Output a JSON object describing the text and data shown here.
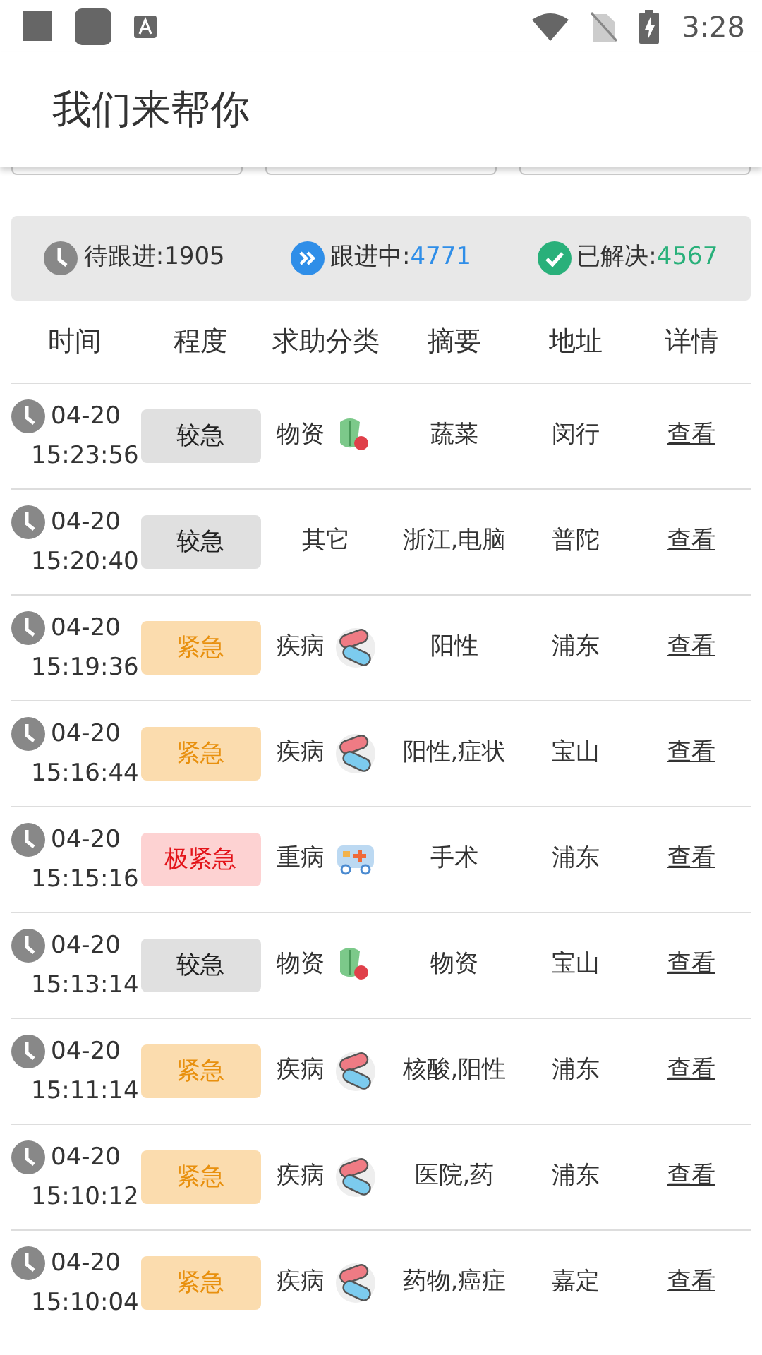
{
  "status_bar": {
    "time": "3:28"
  },
  "app_bar": {
    "title": "我们来帮你"
  },
  "summary": [
    {
      "kind": "pending",
      "label": "待跟进:",
      "count": "1905"
    },
    {
      "kind": "following",
      "label": "跟进中:",
      "count": "4771"
    },
    {
      "kind": "resolved",
      "label": "已解决:",
      "count": "4567"
    }
  ],
  "table": {
    "columns": [
      "时间",
      "程度",
      "求助分类",
      "摘要",
      "地址",
      "详情"
    ],
    "rows": [
      {
        "date": "04-20",
        "time": "15:23:56",
        "urgency": {
          "text": "较急",
          "kind": "moderate"
        },
        "category": {
          "text": "物资",
          "kind": "vegetables"
        },
        "summary": "蔬菜",
        "address": "闵行",
        "detail": "查看"
      },
      {
        "date": "04-20",
        "time": "15:20:40",
        "urgency": {
          "text": "较急",
          "kind": "moderate"
        },
        "category": {
          "text": "其它",
          "kind": "plain"
        },
        "summary": "浙江,电脑",
        "address": "普陀",
        "detail": "查看"
      },
      {
        "date": "04-20",
        "time": "15:19:36",
        "urgency": {
          "text": "紧急",
          "kind": "urgent"
        },
        "category": {
          "text": "疾病",
          "kind": "pills"
        },
        "summary": "阳性",
        "address": "浦东",
        "detail": "查看"
      },
      {
        "date": "04-20",
        "time": "15:16:44",
        "urgency": {
          "text": "紧急",
          "kind": "urgent"
        },
        "category": {
          "text": "疾病",
          "kind": "pills"
        },
        "summary": "阳性,症状",
        "address": "宝山",
        "detail": "查看"
      },
      {
        "date": "04-20",
        "time": "15:15:16",
        "urgency": {
          "text": "极紧急",
          "kind": "critical"
        },
        "category": {
          "text": "重病",
          "kind": "ambulance"
        },
        "summary": "手术",
        "address": "浦东",
        "detail": "查看"
      },
      {
        "date": "04-20",
        "time": "15:13:14",
        "urgency": {
          "text": "较急",
          "kind": "moderate"
        },
        "category": {
          "text": "物资",
          "kind": "vegetables"
        },
        "summary": "物资",
        "address": "宝山",
        "detail": "查看"
      },
      {
        "date": "04-20",
        "time": "15:11:14",
        "urgency": {
          "text": "紧急",
          "kind": "urgent"
        },
        "category": {
          "text": "疾病",
          "kind": "pills"
        },
        "summary": "核酸,阳性",
        "address": "浦东",
        "detail": "查看"
      },
      {
        "date": "04-20",
        "time": "15:10:12",
        "urgency": {
          "text": "紧急",
          "kind": "urgent"
        },
        "category": {
          "text": "疾病",
          "kind": "pills"
        },
        "summary": "医院,药",
        "address": "浦东",
        "detail": "查看"
      },
      {
        "date": "04-20",
        "time": "15:10:04",
        "urgency": {
          "text": "紧急",
          "kind": "urgent"
        },
        "category": {
          "text": "疾病",
          "kind": "pills"
        },
        "summary": "药物,癌症",
        "address": "嘉定",
        "detail": "查看"
      }
    ]
  }
}
